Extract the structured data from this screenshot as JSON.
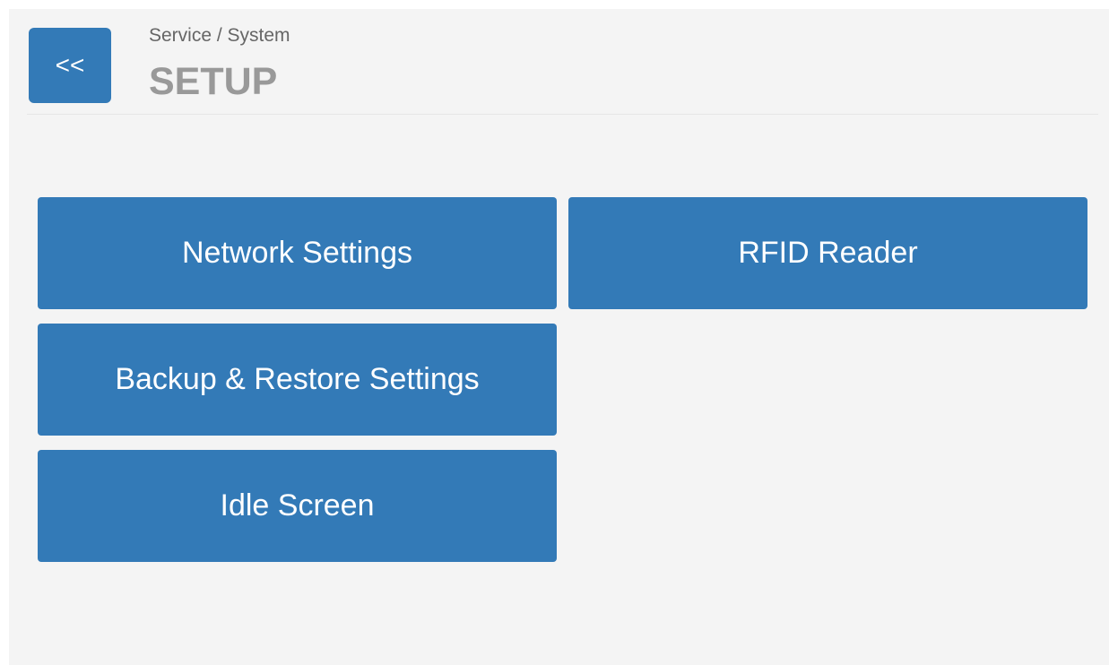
{
  "header": {
    "back_label": "<<",
    "breadcrumb": "Service / System",
    "title": "SETUP"
  },
  "menu": {
    "network_settings": "Network Settings",
    "rfid_reader": "RFID Reader",
    "backup_restore": "Backup & Restore Settings",
    "idle_screen": "Idle Screen"
  },
  "colors": {
    "accent": "#337ab7",
    "background": "#f4f4f4",
    "title_text": "#999999"
  }
}
